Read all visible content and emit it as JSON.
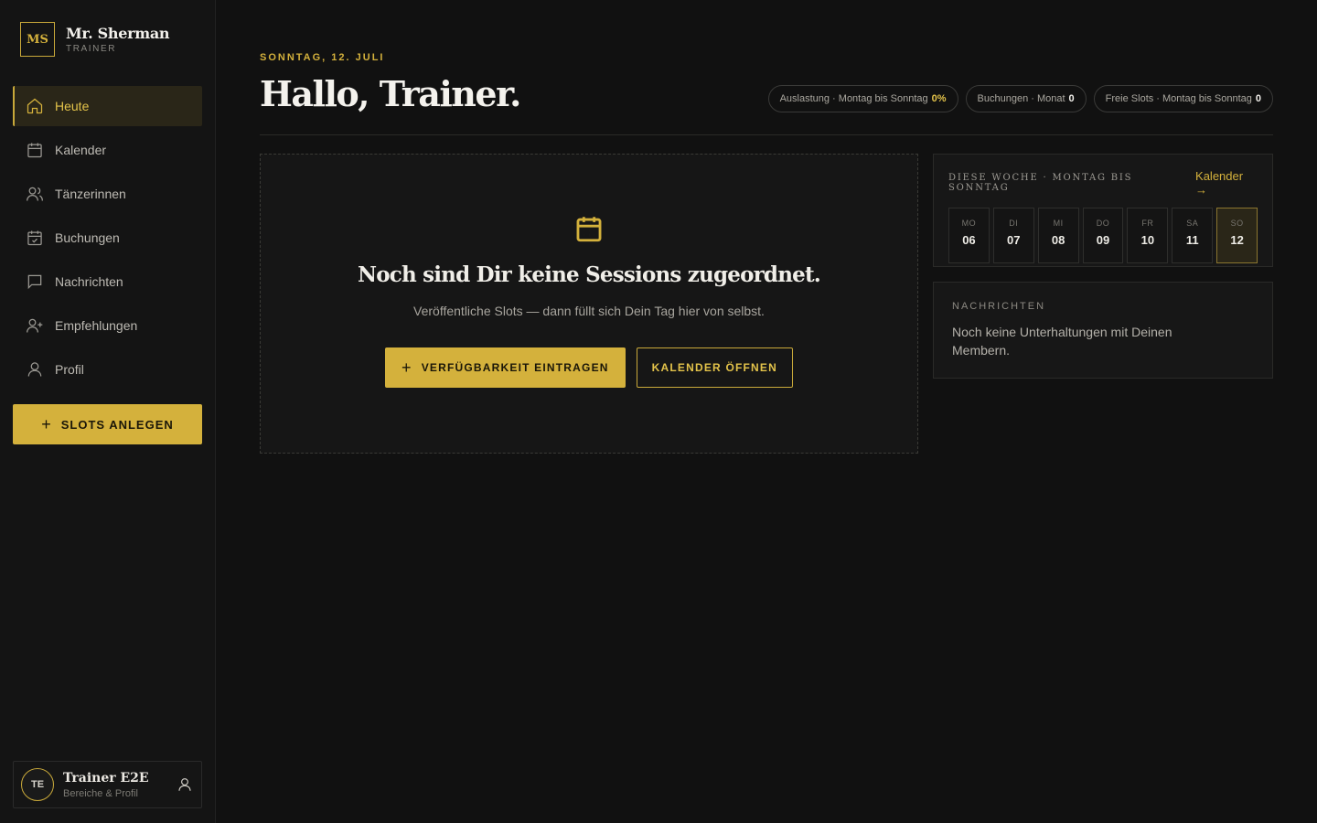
{
  "brand": {
    "logo": "MS",
    "name": "Mr. Sherman",
    "role": "TRAINER"
  },
  "nav": {
    "items": [
      {
        "label": "Heute",
        "icon": "home-icon"
      },
      {
        "label": "Kalender",
        "icon": "calendar-icon"
      },
      {
        "label": "Tänzerinnen",
        "icon": "users-icon"
      },
      {
        "label": "Buchungen",
        "icon": "calendar-check-icon"
      },
      {
        "label": "Nachrichten",
        "icon": "message-icon"
      },
      {
        "label": "Empfehlungen",
        "icon": "user-plus-icon"
      },
      {
        "label": "Profil",
        "icon": "user-icon"
      }
    ],
    "active": "Heute"
  },
  "slots_button": {
    "label": "SLOTS ANLEGEN",
    "icon": "plus-icon"
  },
  "user": {
    "initials": "TE",
    "name": "Trainer E2E",
    "sub": "Bereiche & Profil"
  },
  "header": {
    "date": "SONNTAG, 12. JULI",
    "greeting": "Hallo, Trainer.",
    "stats": [
      {
        "label": "Auslastung · Montag bis Sonntag",
        "value": "0%"
      },
      {
        "label": "Buchungen · Monat",
        "value": "0"
      },
      {
        "label": "Freie Slots · Montag bis Sonntag",
        "value": "0"
      }
    ]
  },
  "empty_state": {
    "icon": "calendar-icon",
    "title": "Noch sind Dir keine Sessions zugeordnet.",
    "subtitle": "Veröffentliche Slots — dann füllt sich Dein Tag hier von selbst.",
    "primary_button": "VERFÜGBARKEIT EINTRAGEN",
    "secondary_button": "KALENDER ÖFFNEN"
  },
  "week": {
    "title": "DIESE WOCHE · MONTAG BIS SONNTAG",
    "link": "Kalender →",
    "days": [
      {
        "name": "MO",
        "date": "06"
      },
      {
        "name": "DI",
        "date": "07"
      },
      {
        "name": "MI",
        "date": "08"
      },
      {
        "name": "DO",
        "date": "09"
      },
      {
        "name": "FR",
        "date": "10"
      },
      {
        "name": "SA",
        "date": "11"
      },
      {
        "name": "SO",
        "date": "12"
      }
    ],
    "today": "12"
  },
  "messages": {
    "label": "NACHRICHTEN",
    "text": "Noch keine Unterhaltungen mit Deinen Membern."
  },
  "colors": {
    "accent": "#d4b13c",
    "background": "#111111",
    "sidebar": "#141414"
  }
}
